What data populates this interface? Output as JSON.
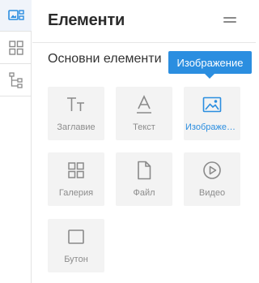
{
  "rail": {
    "items": [
      {
        "icon": "elements-icon",
        "active": true
      },
      {
        "icon": "grid-icon",
        "active": false
      },
      {
        "icon": "tree-icon",
        "active": false
      }
    ]
  },
  "panel": {
    "title": "Елементи",
    "section_title": "Основни елементи"
  },
  "tooltip": {
    "text": "Изображение"
  },
  "tiles": [
    {
      "label": "Заглавие",
      "icon": "heading-icon"
    },
    {
      "label": "Текст",
      "icon": "text-icon"
    },
    {
      "label": "Изображение",
      "icon": "image-icon",
      "selected": true
    },
    {
      "label": "Галерия",
      "icon": "gallery-icon"
    },
    {
      "label": "Файл",
      "icon": "file-icon"
    },
    {
      "label": "Видео",
      "icon": "video-icon"
    },
    {
      "label": "Бутон",
      "icon": "button-icon"
    }
  ],
  "colors": {
    "accent": "#2b8ee0",
    "tile_bg": "#f3f3f3",
    "icon_gray": "#8a8a8a"
  }
}
